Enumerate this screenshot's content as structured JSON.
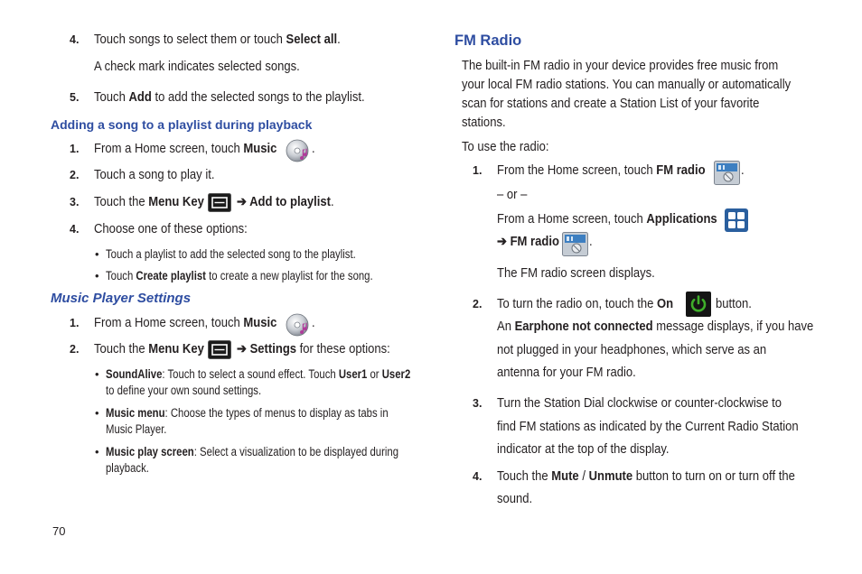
{
  "page_number": "70",
  "left": {
    "step4_num": "4.",
    "step4_text": "Touch songs to select them or touch ",
    "step4_bold": "Select all",
    "step4_end": ".",
    "check_note": "A check mark indicates selected songs.",
    "step5_num": "5.",
    "step5_a": "Touch ",
    "step5_bold": "Add",
    "step5_b": " to add the selected songs to the playlist.",
    "heading_adding": "Adding a song to a playlist during playback",
    "a1_num": "1.",
    "a1_a": "From a Home screen, touch ",
    "a1_bold": "Music",
    "a1_end": ".",
    "a2_num": "2.",
    "a2_text": "Touch a song to play it.",
    "a3_num": "3.",
    "a3_a": "Touch the ",
    "a3_bold": "Menu Key",
    "a3_arrow": "➔ ",
    "a3_bold2": "Add to playlist",
    "a3_end": ".",
    "a4_num": "4.",
    "a4_text": "Choose one of these options:",
    "opt1": "Touch a playlist to add the selected song to the playlist.",
    "opt2_a": "Touch ",
    "opt2_bold": "Create playlist",
    "opt2_b": " to create a new playlist for the song.",
    "heading_settings": "Music Player Settings",
    "s1_num": "1.",
    "s1_a": "From a Home screen, touch ",
    "s1_bold": "Music",
    "s1_end": ".",
    "s2_num": "2.",
    "s2_a": "Touch the ",
    "s2_bold": "Menu Key",
    "s2_arrow": "➔ ",
    "s2_bold2": "Settings",
    "s2_b": " for these options:",
    "b1_bold": "SoundAlive",
    "b1_a": ": Touch to select a sound effect. Touch ",
    "b1_bold2": "User1",
    "b1_or": " or ",
    "b1_bold3": "User2",
    "b1_line2": "to define your own sound settings.",
    "b2_bold": "Music menu",
    "b2_a": ": Choose the types of menus to display as tabs in",
    "b2_line2": "Music Player.",
    "b3_bold": "Music play screen",
    "b3_a": ": Select a visualization to be displayed during",
    "b3_line2": "playback.",
    "bullet_char": "•"
  },
  "right": {
    "heading_fm": "FM Radio",
    "intro1": "The built-in FM radio in your device provides free music from",
    "intro2": "your local FM radio stations. You can manually or automatically",
    "intro3": "scan for stations and create a Station List of your favorite",
    "intro4": "stations.",
    "use_radio": "To use the radio:",
    "r1_num": "1.",
    "r1_a": "From the Home screen, touch ",
    "r1_bold": "FM radio",
    "r1_end": ".",
    "or_text": "– or –",
    "r1b_a": "From a Home screen, touch ",
    "r1b_bold": "Applications",
    "r1c_arrow": "➔ ",
    "r1c_bold": "FM radio",
    "r1c_end": ".",
    "displays": "The FM radio screen displays.",
    "r2_num": "2.",
    "r2_a": "To turn the radio on, touch the ",
    "r2_bold": "On",
    "r2_b": "button.",
    "r2_l2_a": "An ",
    "r2_l2_bold": "Earphone not connected",
    "r2_l2_b": " message displays, if you have",
    "r2_l3": "not plugged in your headphones, which serve as an",
    "r2_l4": "antenna for your FM radio.",
    "r3_num": "3.",
    "r3_l1": "Turn the Station Dial clockwise or counter-clockwise to",
    "r3_l2": "find FM stations as indicated by the Current Radio Station",
    "r3_l3": "indicator at the top of the display.",
    "r4_num": "4.",
    "r4_a": "Touch the ",
    "r4_bold": "Mute",
    "r4_slash": " / ",
    "r4_bold2": "Unmute",
    "r4_b": " button to turn on or turn off the",
    "r4_l2": "sound."
  },
  "colors": {
    "heading": "#2e4da1",
    "text": "#231f20",
    "power_green": "#3fae2a"
  },
  "icons": [
    "music-icon",
    "menu-key-icon",
    "fm-radio-icon",
    "applications-icon",
    "power-on-icon"
  ]
}
